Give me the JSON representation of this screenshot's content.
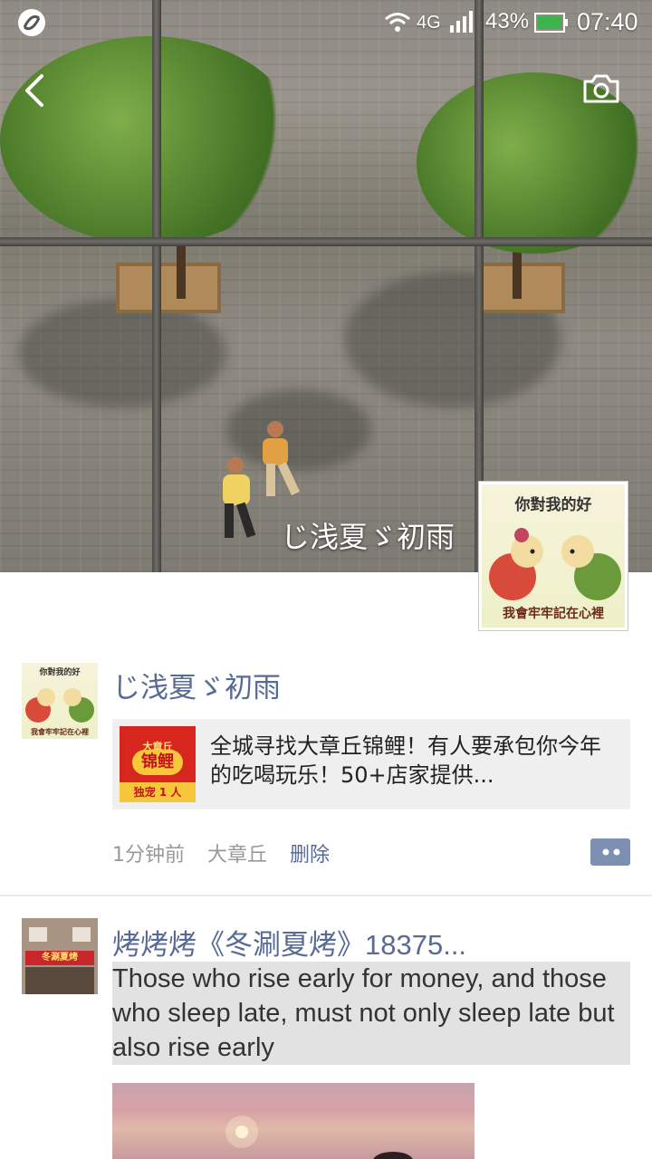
{
  "status_bar": {
    "network": "4G",
    "battery": "43%",
    "time": "07:40"
  },
  "profile": {
    "cover_name": "じ浅夏ゞ初雨",
    "avatar_caption_top": "你對我的好",
    "avatar_caption_bottom": "我會牢牢記在心裡"
  },
  "feed": [
    {
      "poster": "じ浅夏ゞ初雨",
      "avatar_caption_top": "你對我的好",
      "avatar_caption_bottom": "我會牢牢記在心裡",
      "link": {
        "title": "全城寻找大章丘锦鲤！有人要承包你今年的吃喝玩乐！50+店家提供...",
        "thumb_top": "大章丘",
        "thumb_main": "锦鲤",
        "thumb_bottom": "独宠 1 人"
      },
      "time": "1分钟前",
      "location": "大章丘",
      "delete": "删除"
    },
    {
      "poster": "烤烤烤《冬涮夏烤》18375...",
      "avatar_sign": "冬涮夏烤",
      "text": "Those who rise early for money, and those who sleep late, must not only sleep late but also rise early"
    }
  ],
  "colors": {
    "link_blue": "#576b95",
    "meta_gray": "#999999",
    "card_bg": "#efefef"
  }
}
